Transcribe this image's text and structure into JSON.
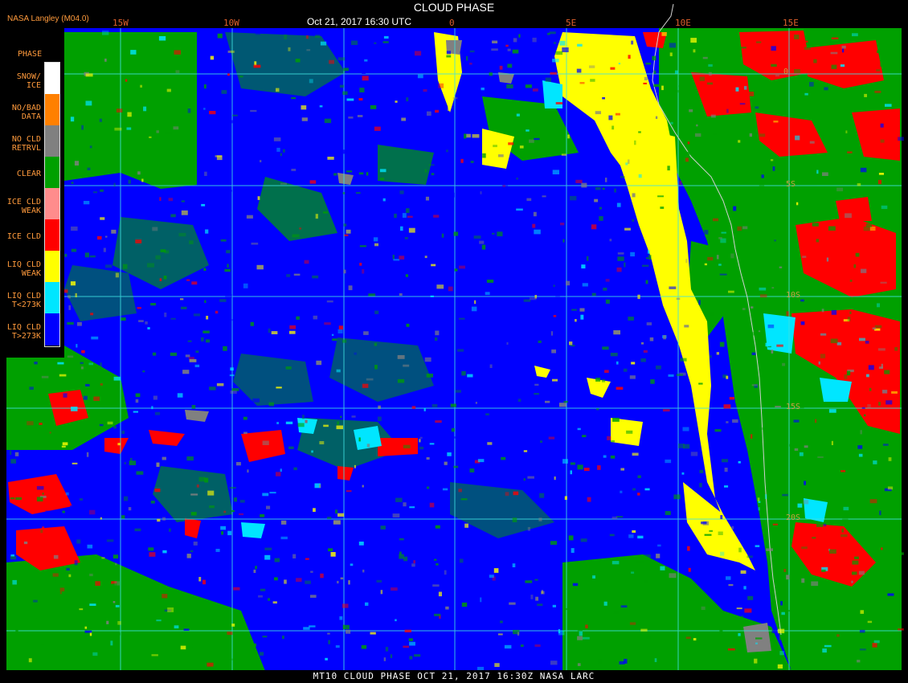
{
  "header": {
    "title": "CLOUD PHASE",
    "date": "Oct 21, 2017 16:30 UTC",
    "org": "NASA Langley (M04.0)"
  },
  "footer": {
    "text": "MT10  CLOUD PHASE   OCT 21, 2017 16:30Z   NASA LARC"
  },
  "longitude_labels": [
    "15W",
    "10W",
    "0",
    "5E",
    "10E",
    "15E"
  ],
  "latitude_labels": [
    "0",
    "5S",
    "10S",
    "15S",
    "20S"
  ],
  "legend": {
    "title": "PHASE",
    "items": [
      {
        "label": "SNOW/\nICE",
        "color": "#ffffff"
      },
      {
        "label": "NO/BAD\nDATA",
        "color": "#ff8000"
      },
      {
        "label": "NO CLD\nRETRVL",
        "color": "#808080"
      },
      {
        "label": "CLEAR",
        "color": "#00a000"
      },
      {
        "label": "ICE CLD\nWEAK",
        "color": "#ff8c8c"
      },
      {
        "label": "ICE CLD",
        "color": "#ff0000"
      },
      {
        "label": "LIQ CLD\nWEAK",
        "color": "#ffff00"
      },
      {
        "label": "LIQ CLD\nT<273K",
        "color": "#00e6ff"
      },
      {
        "label": "LIQ CLD\nT>273K",
        "color": "#0000ff"
      }
    ]
  },
  "colors": {
    "grid": "#40e0e0",
    "coast": "#d0d0d0",
    "background": "#000000"
  }
}
